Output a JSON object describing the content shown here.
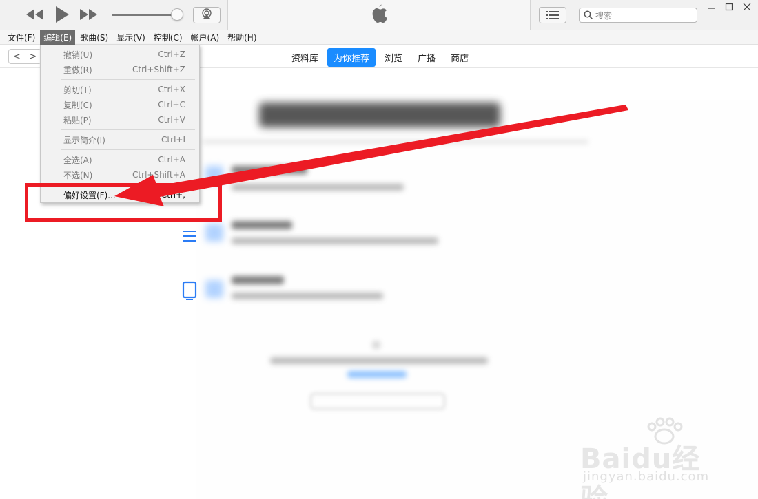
{
  "player": {
    "rewind_icon": "rewind-icon",
    "play_icon": "play-icon",
    "forward_icon": "fast-forward-icon",
    "airplay_icon": "airplay-icon",
    "apple_logo": "apple-logo",
    "list_icon": "list-icon",
    "search_placeholder": "搜索"
  },
  "window_controls": [
    "minimize",
    "maximize",
    "close"
  ],
  "menubar": {
    "items": [
      {
        "label": "文件(F)"
      },
      {
        "label": "编辑(E)"
      },
      {
        "label": "歌曲(S)"
      },
      {
        "label": "显示(V)"
      },
      {
        "label": "控制(C)"
      },
      {
        "label": "帐户(A)"
      },
      {
        "label": "帮助(H)"
      }
    ]
  },
  "nav": {
    "back": "<",
    "forward": ">",
    "tabs": [
      {
        "label": "资料库"
      },
      {
        "label": "为你推荐"
      },
      {
        "label": "浏览"
      },
      {
        "label": "广播"
      },
      {
        "label": "商店"
      }
    ],
    "active_tab": "为你推荐"
  },
  "edit_menu": {
    "items": [
      {
        "label": "撤销(U)",
        "shortcut": "Ctrl+Z"
      },
      {
        "label": "重做(R)",
        "shortcut": "Ctrl+Shift+Z"
      },
      {
        "label": "剪切(T)",
        "shortcut": "Ctrl+X"
      },
      {
        "label": "复制(C)",
        "shortcut": "Ctrl+C"
      },
      {
        "label": "粘贴(P)",
        "shortcut": "Ctrl+V"
      },
      {
        "label": "显示简介(I)",
        "shortcut": "Ctrl+I"
      },
      {
        "label": "全选(A)",
        "shortcut": "Ctrl+A"
      },
      {
        "label": "不选(N)",
        "shortcut": "Ctrl+Shift+A"
      },
      {
        "label": "偏好设置(F)...",
        "shortcut": "Ctrl+,"
      }
    ]
  },
  "annotation": {
    "color": "#ec1b24"
  },
  "watermark": {
    "logo": "Baidu经验",
    "url": "jingyan.baidu.com"
  },
  "colors": {
    "accent": "#1a8cff",
    "menu_active": "#6d6d6d"
  }
}
